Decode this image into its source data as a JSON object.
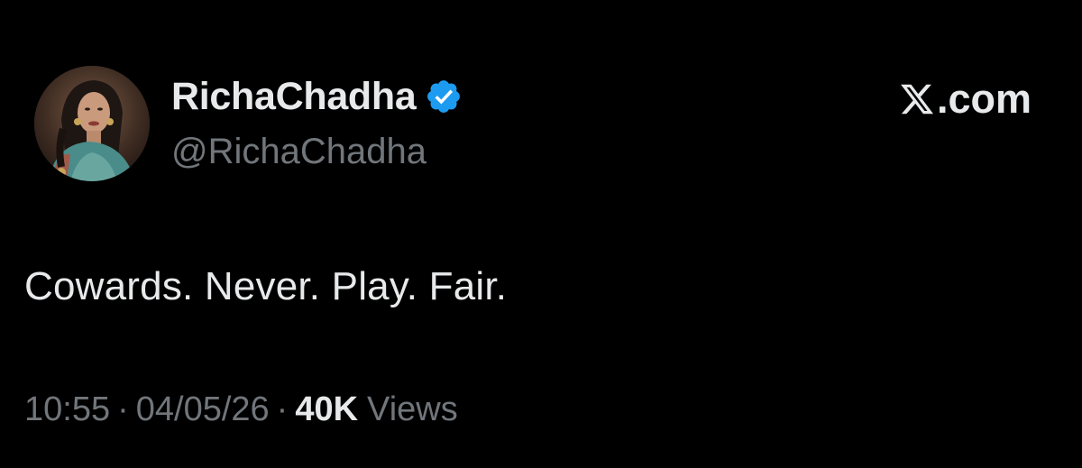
{
  "author": {
    "display_name": "RichaChadha",
    "handle": "@RichaChadha",
    "verified_icon": "verified-badge-icon",
    "avatar": "profile-photo"
  },
  "brand": {
    "logo_icon": "x-logo-icon",
    "label": ".com"
  },
  "tweet": {
    "text": "Cowards. Never. Play. Fair."
  },
  "meta": {
    "time": "10:55",
    "separator": "·",
    "date": "04/05/26",
    "views_count": "40K",
    "views_label": "Views"
  },
  "colors": {
    "background": "#000000",
    "primary_text": "#e7e9ea",
    "secondary_text": "#71767b",
    "verified_blue": "#1d9bf0"
  }
}
